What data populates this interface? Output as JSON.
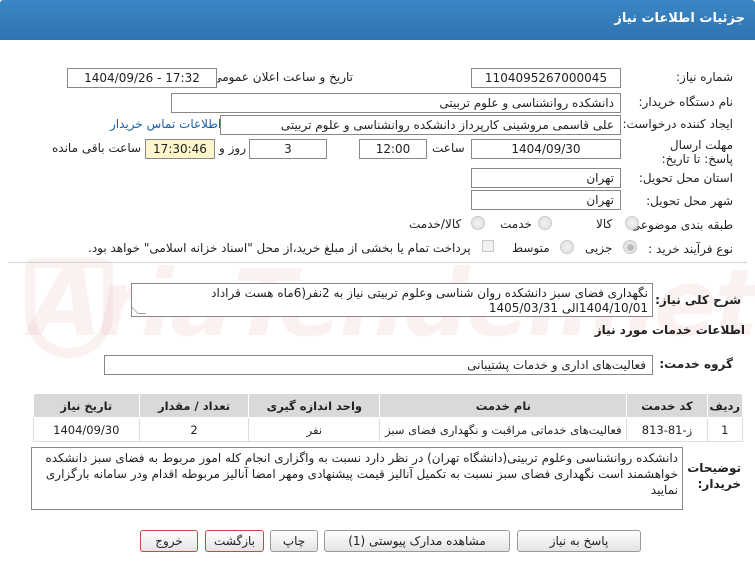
{
  "window": {
    "title": "جزئیات اطلاعات نیاز"
  },
  "watermark": {
    "text": "AriaTender.net"
  },
  "form": {
    "need_number": {
      "label": "شماره نیاز:",
      "value": "1104095267000045"
    },
    "announce_datetime": {
      "label": "تاریخ و ساعت اعلان عمومی:",
      "value": "1404/09/26 - 17:32"
    },
    "buyer_org": {
      "label": "نام دستگاه خریدار:",
      "value": "دانشکده روانشناسی و علوم تربیتی"
    },
    "requester": {
      "label": "ایجاد کننده درخواست:",
      "value": "علی قاسمی مروشینی کارپرداز دانشکده روانشناسی و علوم تربیتی"
    },
    "contact_link": "اطلاعات تماس خریدار",
    "deadline": {
      "label": "مهلت ارسال پاسخ: تا تاریخ:",
      "date": "1404/09/30",
      "time_label": "ساعت",
      "time": "12:00",
      "days": "3",
      "days_label": "روز و",
      "remaining": "17:30:46",
      "remaining_label": "ساعت باقی مانده"
    },
    "province": {
      "label": "استان محل تحویل:",
      "value": "تهران"
    },
    "city": {
      "label": "شهر محل تحویل:",
      "value": "تهران"
    },
    "category": {
      "label": "طبقه بندی موضوعی:",
      "options": [
        "کالا",
        "خدمت",
        "کالا/خدمت"
      ],
      "selected": "خدمت"
    },
    "purchase_type": {
      "label": "نوع فرآیند خرید :",
      "options": [
        "جزیی",
        "متوسط"
      ],
      "selected": "جزیی",
      "payment_note": "پرداخت تمام یا بخشی از مبلغ خرید،از محل \"اسناد خزانه اسلامی\" خواهد بود."
    }
  },
  "general_description": {
    "label": "شرح کلی نیاز:",
    "value": "نگهداری فضای سبز دانشکده روان شناسی وعلوم تربیتی نیاز به 2نفر(6ماه هست قراداد 1404/10/01الی 1405/03/31"
  },
  "services_section": {
    "heading": "اطلاعات خدمات مورد نیاز",
    "group_label": "گروه خدمت:",
    "group_value": "فعالیت‌های اداری و خدمات پشتیبانی"
  },
  "table": {
    "columns": [
      "ردیف",
      "کد خدمت",
      "نام خدمت",
      "واحد اندازه گیری",
      "تعداد / مقدار",
      "تاریخ نیاز"
    ],
    "rows": [
      [
        "1",
        "ز-81-813",
        "فعالیت‌های خدماتی مراقبت و نگهداری فضای سبز",
        "نفر",
        "2",
        "1404/09/30"
      ]
    ]
  },
  "buyer_notes": {
    "label": "توضیحات خریدار:",
    "value": "دانشکده روانشناسی وعلوم تربیتی(دانشگاه تهران) در نظر دارد نسبت به واگزاری انجام کله امور مربوط به فضای سبز دانشکده  خواهشمند است  نگهداری فضای سبز نسبت به تکمیل آنالیز قیمت پیشنهادی ومهر امضا آنالیز  مربوطه اقدام  ودر سامانه بارگزاری نمایید"
  },
  "buttons": {
    "reply": "پاسخ به نیاز",
    "attachments": "مشاهده مدارک پیوستی (1)",
    "print": "چاپ",
    "back": "بازگشت",
    "exit": "خروج"
  }
}
